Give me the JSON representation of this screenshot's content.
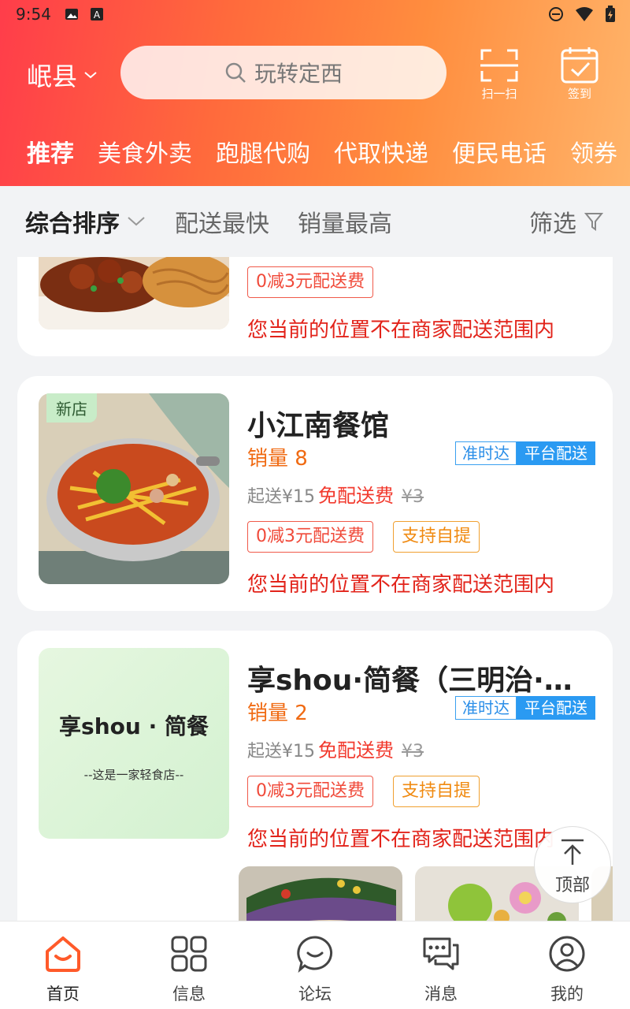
{
  "status": {
    "time": "9:54"
  },
  "header": {
    "location": "岷县",
    "search_placeholder": "玩转定西",
    "scan_label": "扫一扫",
    "signin_label": "签到"
  },
  "tabs": [
    "推荐",
    "美食外卖",
    "跑腿代购",
    "代取快递",
    "便民电话",
    "领券"
  ],
  "sort": {
    "comprehensive": "综合排序",
    "fastest": "配送最快",
    "top_sales": "销量最高",
    "filter": "筛选"
  },
  "shops": [
    {
      "name": "",
      "tag_discount": "0减3元配送费",
      "warning": "您当前的位置不在商家配送范围内"
    },
    {
      "name": "小江南餐馆",
      "new_badge": "新店",
      "sales": "销量 8",
      "badge_ontime": "准时达",
      "badge_platform": "平台配送",
      "min_order": "起送¥15",
      "free_delivery": "免配送费",
      "old_fee": "¥3",
      "tag_discount": "0减3元配送费",
      "tag_pickup": "支持自提",
      "warning": "您当前的位置不在商家配送范围内"
    },
    {
      "name": "享shou·简餐（三明治·沙…",
      "thumb_title": "享shou · 简餐",
      "thumb_subtitle": "--这是一家轻食店--",
      "sales": "销量 2",
      "badge_ontime": "准时达",
      "badge_platform": "平台配送",
      "min_order": "起送¥15",
      "free_delivery": "免配送费",
      "old_fee": "¥3",
      "tag_discount": "0减3元配送费",
      "tag_pickup": "支持自提",
      "warning": "您当前的位置不在商家配送范围内"
    }
  ],
  "gotop_label": "顶部",
  "bottom_nav": [
    {
      "label": "首页",
      "icon": "home-icon",
      "active": true
    },
    {
      "label": "信息",
      "icon": "grid-icon"
    },
    {
      "label": "论坛",
      "icon": "forum-icon"
    },
    {
      "label": "消息",
      "icon": "message-icon"
    },
    {
      "label": "我的",
      "icon": "profile-icon"
    }
  ],
  "colors": {
    "accent": "#ff6a3c",
    "warning": "#e2231a",
    "sales": "#f06a12",
    "badge_blue": "#2a9af2"
  }
}
